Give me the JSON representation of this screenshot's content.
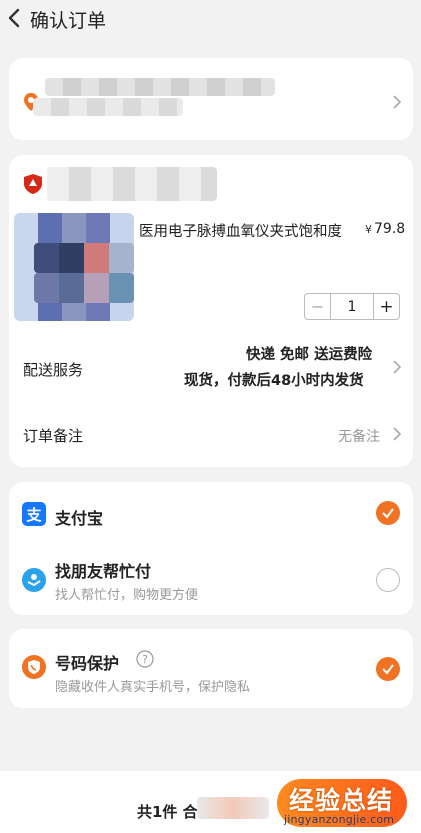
{
  "header": {
    "title": "确认订单"
  },
  "product": {
    "name": "医用电子脉搏血氧仪夹式饱和度",
    "price_symbol": "¥",
    "price": "79.8",
    "quantity": "1",
    "minus": "−",
    "plus": "+"
  },
  "delivery": {
    "label": "配送服务",
    "line1": "快递 免邮 送运费险",
    "line2": "现货，付款后48小时内发货"
  },
  "remark": {
    "label": "订单备注",
    "value": "无备注"
  },
  "payment": {
    "alipay_label": "支付宝",
    "friend_label": "找朋友帮忙付",
    "friend_sub": "找人帮忙付，购物更方便"
  },
  "privacy": {
    "label": "号码保护",
    "sub": "隐藏收件人真实手机号，保护隐私"
  },
  "footer": {
    "count": "共1件 合",
    "watermark_cn": "经验总结",
    "watermark_url": "jingyanzongjie.com"
  },
  "colors": {
    "accent": "#f07222",
    "alipay": "#1677ff",
    "friend": "#2aa1e8"
  },
  "icons": {
    "back": "chevron-left-icon",
    "chevron": "chevron-right-icon",
    "check": "check-icon",
    "help": "question-circle-icon"
  }
}
